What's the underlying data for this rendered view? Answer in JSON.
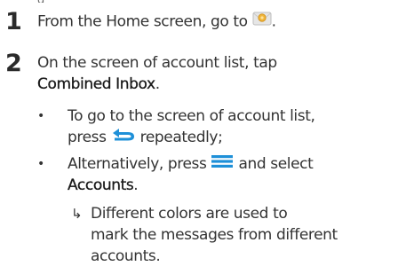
{
  "clipped_top_text": "g",
  "steps": [
    {
      "number": "1",
      "text_before_icon": "From the Home screen, go to",
      "icon": "mail-app-icon",
      "text_after_icon": "."
    },
    {
      "number": "2",
      "line1": "On the screen of account list, tap",
      "line2_bold": "Combined Inbox",
      "line2_after": "."
    }
  ],
  "bullets": [
    {
      "line1": "To go to the screen of account list,",
      "line2_before_icon": "press",
      "line2_icon": "back-arrow-icon",
      "line2_after_icon": "repeatedly;"
    },
    {
      "line1_before_icon": "Alternatively, press",
      "line1_icon": "menu-icon",
      "line1_after_icon": "and select",
      "line2_bold": "Accounts",
      "line2_after": "."
    }
  ],
  "result": {
    "marker": "↳",
    "line1": "Different colors are used to",
    "line2": "mark the messages from different",
    "line3": "accounts."
  },
  "colors": {
    "icon_blue": "#1e90d8",
    "mail_icon_yellow": "#f0b53a",
    "mail_icon_body": "#e6e6e6"
  }
}
